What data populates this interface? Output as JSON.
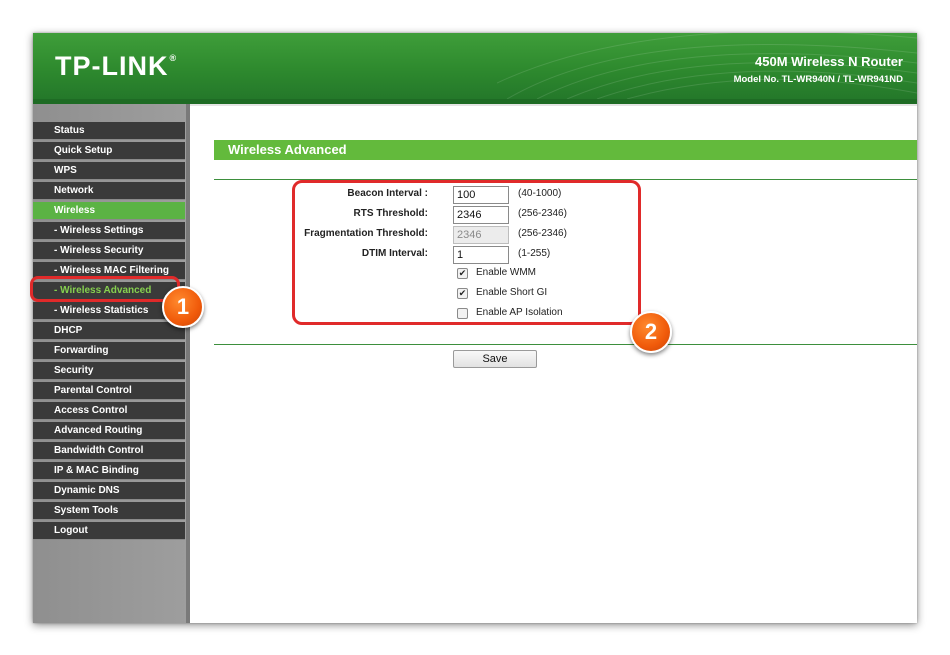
{
  "header": {
    "logo": "TP-LINK",
    "logo_mark": "®",
    "product": "450M Wireless N Router",
    "model": "Model No. TL-WR940N / TL-WR941ND"
  },
  "sidebar": {
    "items": [
      {
        "label": "Status",
        "state": "normal"
      },
      {
        "label": "Quick Setup",
        "state": "normal"
      },
      {
        "label": "WPS",
        "state": "normal"
      },
      {
        "label": "Network",
        "state": "normal"
      },
      {
        "label": "Wireless",
        "state": "active"
      },
      {
        "label": "- Wireless Settings",
        "state": "normal"
      },
      {
        "label": "- Wireless Security",
        "state": "normal"
      },
      {
        "label": "- Wireless MAC Filtering",
        "state": "normal"
      },
      {
        "label": "- Wireless Advanced",
        "state": "selected"
      },
      {
        "label": "- Wireless Statistics",
        "state": "normal"
      },
      {
        "label": "DHCP",
        "state": "normal"
      },
      {
        "label": "Forwarding",
        "state": "normal"
      },
      {
        "label": "Security",
        "state": "normal"
      },
      {
        "label": "Parental Control",
        "state": "normal"
      },
      {
        "label": "Access Control",
        "state": "normal"
      },
      {
        "label": "Advanced Routing",
        "state": "normal"
      },
      {
        "label": "Bandwidth Control",
        "state": "normal"
      },
      {
        "label": "IP & MAC Binding",
        "state": "normal"
      },
      {
        "label": "Dynamic DNS",
        "state": "normal"
      },
      {
        "label": "System Tools",
        "state": "normal"
      },
      {
        "label": "Logout",
        "state": "normal"
      }
    ]
  },
  "main": {
    "title": "Wireless Advanced",
    "fields": [
      {
        "label": "Beacon Interval :",
        "value": "100",
        "range": "(40-1000)",
        "disabled": false
      },
      {
        "label": "RTS Threshold:",
        "value": "2346",
        "range": "(256-2346)",
        "disabled": false
      },
      {
        "label": "Fragmentation Threshold:",
        "value": "2346",
        "range": "(256-2346)",
        "disabled": true
      },
      {
        "label": "DTIM Interval:",
        "value": "1",
        "range": "(1-255)",
        "disabled": false
      }
    ],
    "checkboxes": [
      {
        "label": "Enable WMM",
        "checked": true
      },
      {
        "label": "Enable Short GI",
        "checked": true
      },
      {
        "label": "Enable AP Isolation",
        "checked": false
      }
    ],
    "save_label": "Save"
  },
  "annotations": {
    "badge_1": "1",
    "badge_2": "2"
  },
  "colors": {
    "brand_green": "#2e8a2e",
    "active_green": "#5bb344",
    "selected_text": "#86d04f",
    "annotation_red": "#e02a2a",
    "badge_orange": "#f05a0a"
  }
}
